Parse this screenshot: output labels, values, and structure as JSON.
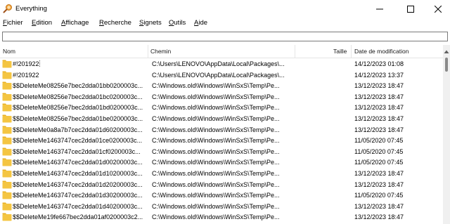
{
  "window": {
    "title": "Everything",
    "icon": "magnifier-icon",
    "controls": [
      "minimize-icon",
      "maximize-icon",
      "close-icon"
    ]
  },
  "menu": [
    {
      "first": "F",
      "rest": "ichier"
    },
    {
      "first": "E",
      "rest": "dition"
    },
    {
      "first": "A",
      "rest": "ffichage"
    },
    {
      "first": "R",
      "rest": "echerche"
    },
    {
      "first": "S",
      "rest": "ignets"
    },
    {
      "first": "O",
      "rest": "utils"
    },
    {
      "first": "A",
      "rest": "ide"
    }
  ],
  "search": {
    "value": "",
    "placeholder": ""
  },
  "columns": {
    "name": "Nom",
    "path": "Chemin",
    "size": "Taille",
    "date": "Date de modification"
  },
  "rows": [
    {
      "name": "#!201922",
      "path": "C:\\Users\\LENOVO\\AppData\\Local\\Packages\\...",
      "size": "",
      "date": "14/12/2023 01:08",
      "selected": true
    },
    {
      "name": "#!201922",
      "path": "C:\\Users\\LENOVO\\AppData\\Local\\Packages\\...",
      "size": "",
      "date": "14/12/2023 13:37"
    },
    {
      "name": "$$DeleteMe08256e7bec2dda01bb0200003c...",
      "path": "C:\\Windows.old\\Windows\\WinSxS\\Temp\\Pe...",
      "size": "",
      "date": "13/12/2023 18:47"
    },
    {
      "name": "$$DeleteMe08256e7bec2dda01bc0200003c...",
      "path": "C:\\Windows.old\\Windows\\WinSxS\\Temp\\Pe...",
      "size": "",
      "date": "13/12/2023 18:47"
    },
    {
      "name": "$$DeleteMe08256e7bec2dda01bd0200003c...",
      "path": "C:\\Windows.old\\Windows\\WinSxS\\Temp\\Pe...",
      "size": "",
      "date": "13/12/2023 18:47"
    },
    {
      "name": "$$DeleteMe08256e7bec2dda01be0200003c...",
      "path": "C:\\Windows.old\\Windows\\WinSxS\\Temp\\Pe...",
      "size": "",
      "date": "13/12/2023 18:47"
    },
    {
      "name": "$$DeleteMe0a8a7b7cec2dda01d60200003c...",
      "path": "C:\\Windows.old\\Windows\\WinSxS\\Temp\\Pe...",
      "size": "",
      "date": "13/12/2023 18:47"
    },
    {
      "name": "$$DeleteMe1463747cec2dda01ce0200003c...",
      "path": "C:\\Windows.old\\Windows\\WinSxS\\Temp\\Pe...",
      "size": "",
      "date": "11/05/2020 07:45"
    },
    {
      "name": "$$DeleteMe1463747cec2dda01cf0200003c...",
      "path": "C:\\Windows.old\\Windows\\WinSxS\\Temp\\Pe...",
      "size": "",
      "date": "11/05/2020 07:45"
    },
    {
      "name": "$$DeleteMe1463747cec2dda01d00200003c...",
      "path": "C:\\Windows.old\\Windows\\WinSxS\\Temp\\Pe...",
      "size": "",
      "date": "11/05/2020 07:45"
    },
    {
      "name": "$$DeleteMe1463747cec2dda01d10200003c...",
      "path": "C:\\Windows.old\\Windows\\WinSxS\\Temp\\Pe...",
      "size": "",
      "date": "13/12/2023 18:47"
    },
    {
      "name": "$$DeleteMe1463747cec2dda01d20200003c...",
      "path": "C:\\Windows.old\\Windows\\WinSxS\\Temp\\Pe...",
      "size": "",
      "date": "13/12/2023 18:47"
    },
    {
      "name": "$$DeleteMe1463747cec2dda01d30200003c...",
      "path": "C:\\Windows.old\\Windows\\WinSxS\\Temp\\Pe...",
      "size": "",
      "date": "11/05/2020 07:45"
    },
    {
      "name": "$$DeleteMe1463747cec2dda01d40200003c...",
      "path": "C:\\Windows.old\\Windows\\WinSxS\\Temp\\Pe...",
      "size": "",
      "date": "13/12/2023 18:47"
    },
    {
      "name": "$$DeleteMe19fe667bec2dda01af0200003c2...",
      "path": "C:\\Windows.old\\Windows\\WinSxS\\Temp\\Pe...",
      "size": "",
      "date": "13/12/2023 18:47"
    }
  ],
  "colors": {
    "folder": "#f4c542",
    "folder_tab": "#e8b025",
    "border": "#7a7a7a",
    "header_sep": "#e5e5e5",
    "scrollbar": "#f0f0f0"
  }
}
